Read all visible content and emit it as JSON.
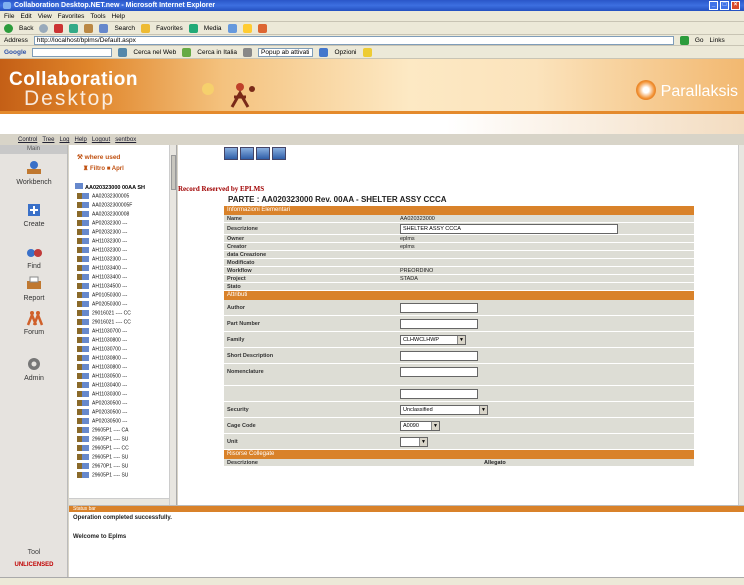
{
  "window": {
    "title": "Collaboration Desktop.NET.new - Microsoft Internet Explorer"
  },
  "menu": [
    "File",
    "Edit",
    "View",
    "Favorites",
    "Tools",
    "Help"
  ],
  "toolbar": {
    "back": "Back",
    "search": "Search",
    "favorites": "Favorites",
    "media": "Media"
  },
  "address": {
    "label": "Address",
    "url": "http://localhost/bplms/Default.aspx",
    "go": "Go",
    "links": "Links"
  },
  "googlebar": {
    "label": "Google",
    "search_web": "Cerca nel Web",
    "search_site": "Cerca in Italia",
    "popup": "Popup ab attivati",
    "options": "Opzioni"
  },
  "header": {
    "logo_line1": "Collaboration",
    "logo_line2": "Desktop",
    "brand": "Parallaksis"
  },
  "navlinks": [
    "Control",
    "Tree",
    "Log",
    "Help",
    "Logout",
    "sentbox"
  ],
  "sidebar": {
    "header": "Main",
    "items": [
      "Workbench",
      "Create",
      "Find",
      "Report",
      "Forum",
      "Admin"
    ],
    "tool": "Tool",
    "license": "UNLICENSED"
  },
  "tree": {
    "title": "where used",
    "filter_label": "Filtro",
    "filter_value": "Aprl",
    "root": "AA020323000 00AA SH",
    "rows": [
      "AA02032300005",
      "AA02032300005F",
      "AA02032300008",
      "AP02032300 ---",
      "AP02032300 ---",
      "AH11032300 ---",
      "AH11032300 ---",
      "AH11032300 ---",
      "AH11033400 ---",
      "AH11033400 ---",
      "AH11034500 ---",
      "AP01050300 ---",
      "AP02050300 ---",
      "29016021 ---- CC",
      "29016021 ---- CC",
      "AH11030700 ---",
      "AH11030800 ---",
      "AH11030700 ---",
      "AH11030800 ---",
      "AH11030800 ---",
      "AH11030500 ---",
      "AH11030400 ---",
      "AH11030300 ---",
      "AP02030500 ---",
      "AP02030500 ---",
      "AP02030500 ---",
      "29605P1 ---- CA",
      "29605P1 ---- SU",
      "29605P1 ---- CC",
      "29605P1 ---- SU",
      "29670P1 ---- SU",
      "29605P1 ---- SU"
    ]
  },
  "main": {
    "reserved_by": "Record Reserved by EPLMS",
    "parte_title": "PARTE : AA020323000 Rev. 00AA - SHELTER ASSY CCCA",
    "sections": {
      "elementary": "Informazioni Elementari",
      "attributes": "Attributi",
      "related": "Risorse Collegate"
    },
    "elementary_fields": [
      {
        "label": "Name",
        "value": "AA020323000"
      },
      {
        "label": "Descrizione",
        "value": "SHELTER ASSY CCCA"
      },
      {
        "label": "Owner",
        "value": "eplms"
      },
      {
        "label": "Creator",
        "value": "eplms"
      },
      {
        "label": "data Creazione",
        "value": ""
      },
      {
        "label": "Modificato",
        "value": ""
      },
      {
        "label": "Workflow",
        "value": "PREORDINO"
      },
      {
        "label": "Project",
        "value": "STADA"
      },
      {
        "label": "Stato",
        "value": ""
      }
    ],
    "attribute_fields": [
      {
        "label": "Author",
        "value": ""
      },
      {
        "label": "Part Number",
        "value": ""
      },
      {
        "label": "Family",
        "value": "CLHWCLHWP"
      },
      {
        "label": "Short Description",
        "value": ""
      },
      {
        "label": "Nomenclature",
        "value": ""
      },
      {
        "label": "",
        "value": ""
      },
      {
        "label": "Security",
        "value": "Unclassified"
      },
      {
        "label": "Cage Code",
        "value": "A0090"
      },
      {
        "label": "Unit",
        "value": ""
      }
    ],
    "related_cols": [
      "Descrizione",
      "Allegato"
    ]
  },
  "bottom": {
    "header": "Status bar",
    "operation": "Operation completed successfully.",
    "welcome": "Welcome to Eplms"
  },
  "colors": {
    "accent": "#d9822a",
    "reserved": "#a00000",
    "titlebar": "#2a56c8"
  }
}
